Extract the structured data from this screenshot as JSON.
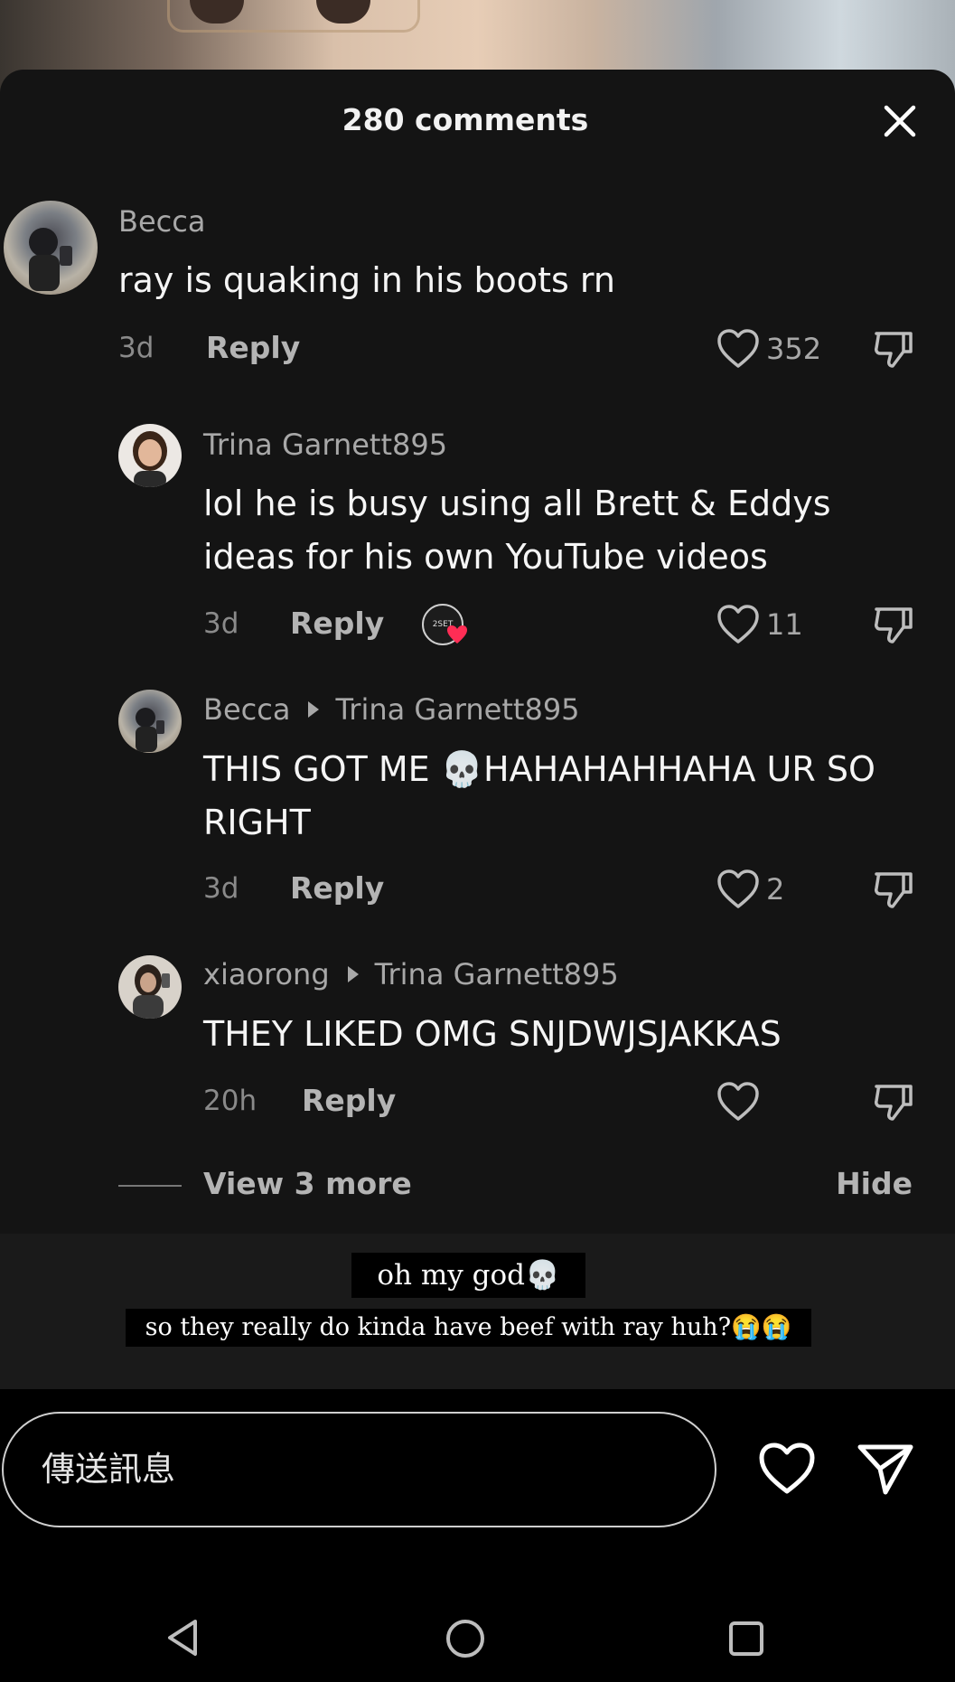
{
  "header": {
    "title": "280 comments"
  },
  "comments": [
    {
      "username": "Becca",
      "text": "ray is quaking in his boots rn",
      "time": "3d",
      "reply_label": "Reply",
      "likes": "352"
    },
    {
      "username": "Trina Garnett895",
      "text": "lol he is busy using all Brett & Eddys ideas for his own YouTube videos",
      "time": "3d",
      "reply_label": "Reply",
      "likes": "11",
      "creator_badge": "2SET"
    },
    {
      "username": "Becca",
      "reply_to": "Trina Garnett895",
      "text": "THIS GOT ME 💀HAHAHAHHAHA UR SO RIGHT",
      "time": "3d",
      "reply_label": "Reply",
      "likes": "2"
    },
    {
      "username": "xiaorong",
      "reply_to": "Trina Garnett895",
      "text": "THEY LIKED OMG SNJDWJSJAKKAS",
      "time": "20h",
      "reply_label": "Reply",
      "likes": ""
    }
  ],
  "thread": {
    "view_more": "View 3 more",
    "hide": "Hide"
  },
  "captions": {
    "line1": "oh my god💀",
    "line2": "so they really do kinda have beef with ray huh?😭😭"
  },
  "composer": {
    "placeholder": "傳送訊息"
  },
  "colors": {
    "sheet_bg": "#141414",
    "like_badge": "#ff2d55"
  }
}
